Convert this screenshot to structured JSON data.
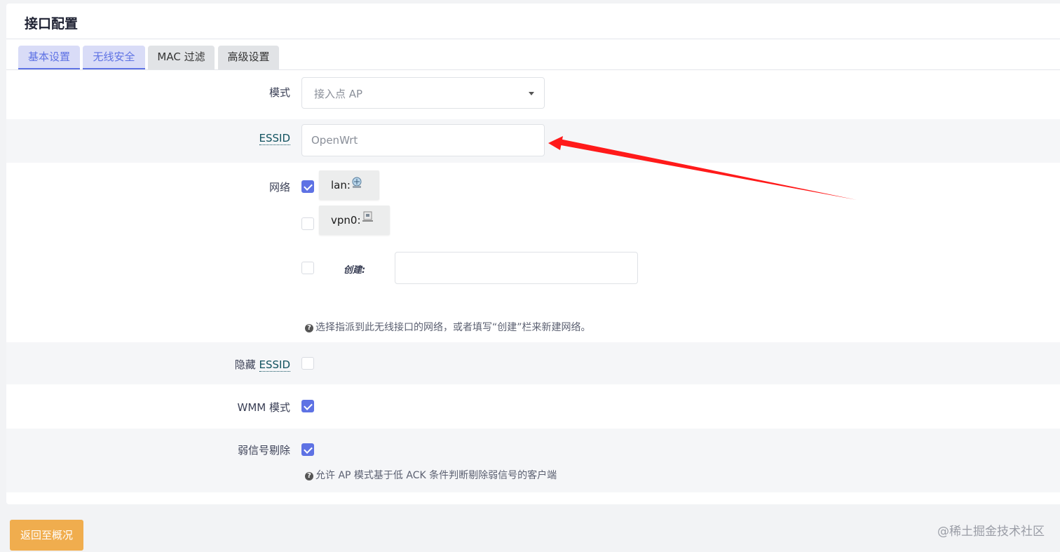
{
  "page": {
    "title": "接口配置"
  },
  "tabs": [
    {
      "label": "基本设置",
      "active": true
    },
    {
      "label": "无线安全",
      "active": true
    },
    {
      "label": "MAC 过滤",
      "active": false
    },
    {
      "label": "高级设置",
      "active": false
    }
  ],
  "form": {
    "mode": {
      "label": "模式",
      "value": "接入点 AP"
    },
    "essid": {
      "label": "ESSID",
      "placeholder": "OpenWrt"
    },
    "network": {
      "label": "网络",
      "options": [
        {
          "name": "lan:",
          "checked": true,
          "icon": "network-bridge-icon"
        },
        {
          "name": "vpn0:",
          "checked": false,
          "icon": "ethernet-port-icon"
        }
      ],
      "create_label": "创建:",
      "create_checked": false,
      "help": "选择指派到此无线接口的网络，或者填写“创建”栏来新建网络。"
    },
    "hidden_essid": {
      "label_prefix": "隐藏 ",
      "label_term": "ESSID",
      "checked": false
    },
    "wmm": {
      "label": "WMM 模式",
      "checked": true
    },
    "disassoc_low_ack": {
      "label": "弱信号剔除",
      "checked": true,
      "help": "允许 AP 模式基于低 ACK 条件判断剔除弱信号的客户端"
    }
  },
  "footer": {
    "back_label": "返回至概况"
  },
  "watermark": "@稀土掘金技术社区",
  "colors": {
    "accent": "#5e72e4",
    "button": "#f0ad4e",
    "annotation_arrow": "#ff0000"
  }
}
